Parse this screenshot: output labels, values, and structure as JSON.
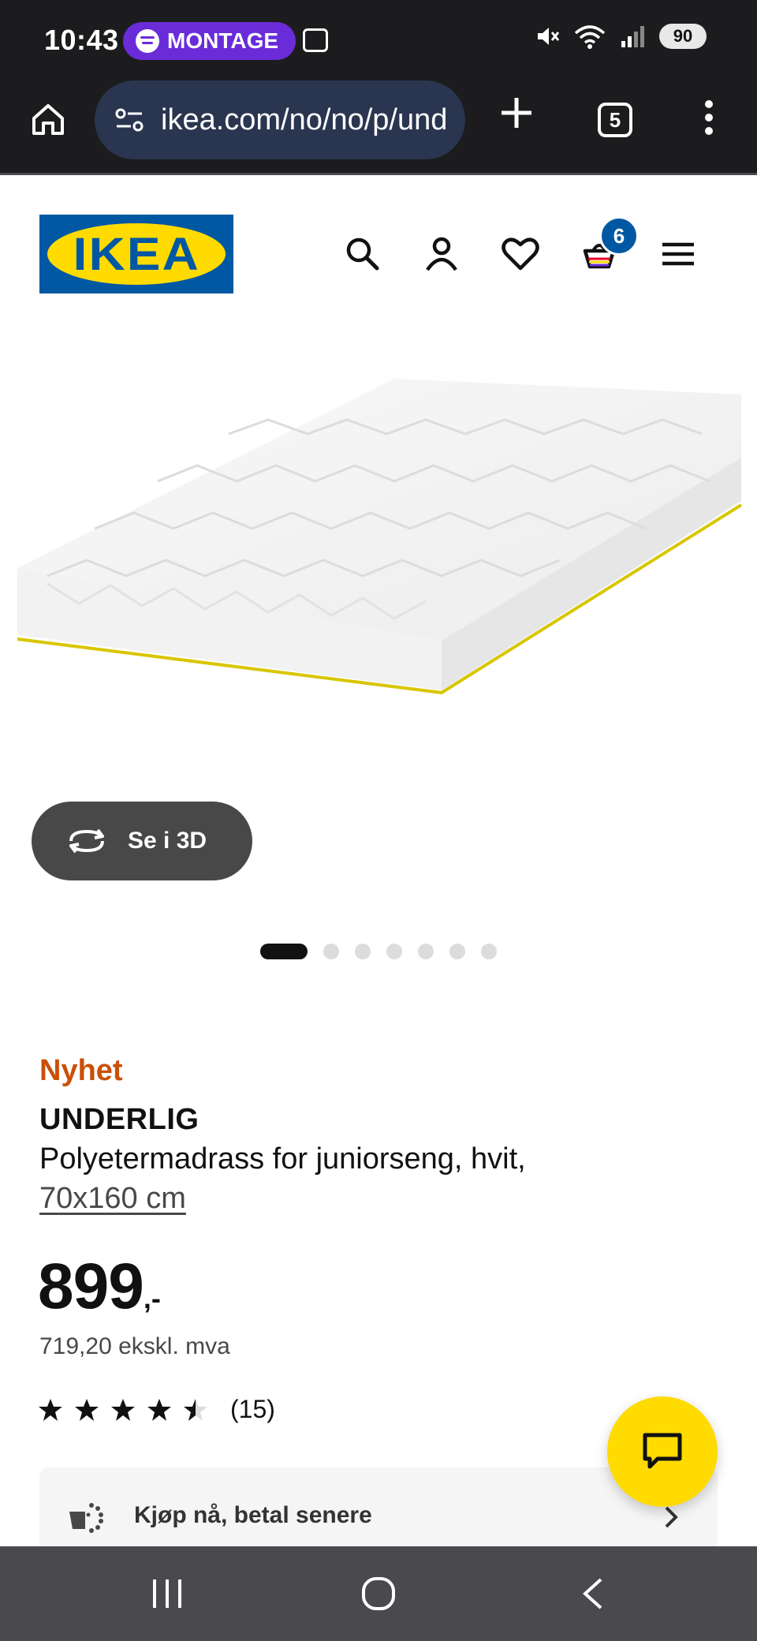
{
  "status_bar": {
    "time": "10:43",
    "media_label": "MONTAGE",
    "battery": "90"
  },
  "browser": {
    "url": "ikea.com/no/no/p/und",
    "tab_count": "5"
  },
  "header": {
    "logo_text": "IKEA",
    "cart_count": "6"
  },
  "gallery": {
    "view_3d_label": "Se i 3D",
    "image_count": 7,
    "active_index": 0
  },
  "product": {
    "badge": "Nyhet",
    "name": "UNDERLIG",
    "description": "Polyetermadrass for juniorseng, hvit,",
    "size": "70x160 cm",
    "price": "899",
    "price_suffix": ",-",
    "price_ex_vat": "719,20 ekskl. mva",
    "rating_value": 4.5,
    "rating_count": "(15)"
  },
  "buy_now": {
    "label": "Kjøp nå, betal senere"
  },
  "colors": {
    "ikea_blue": "#0058a3",
    "ikea_yellow": "#ffdb00",
    "new_badge": "#ca5008"
  }
}
